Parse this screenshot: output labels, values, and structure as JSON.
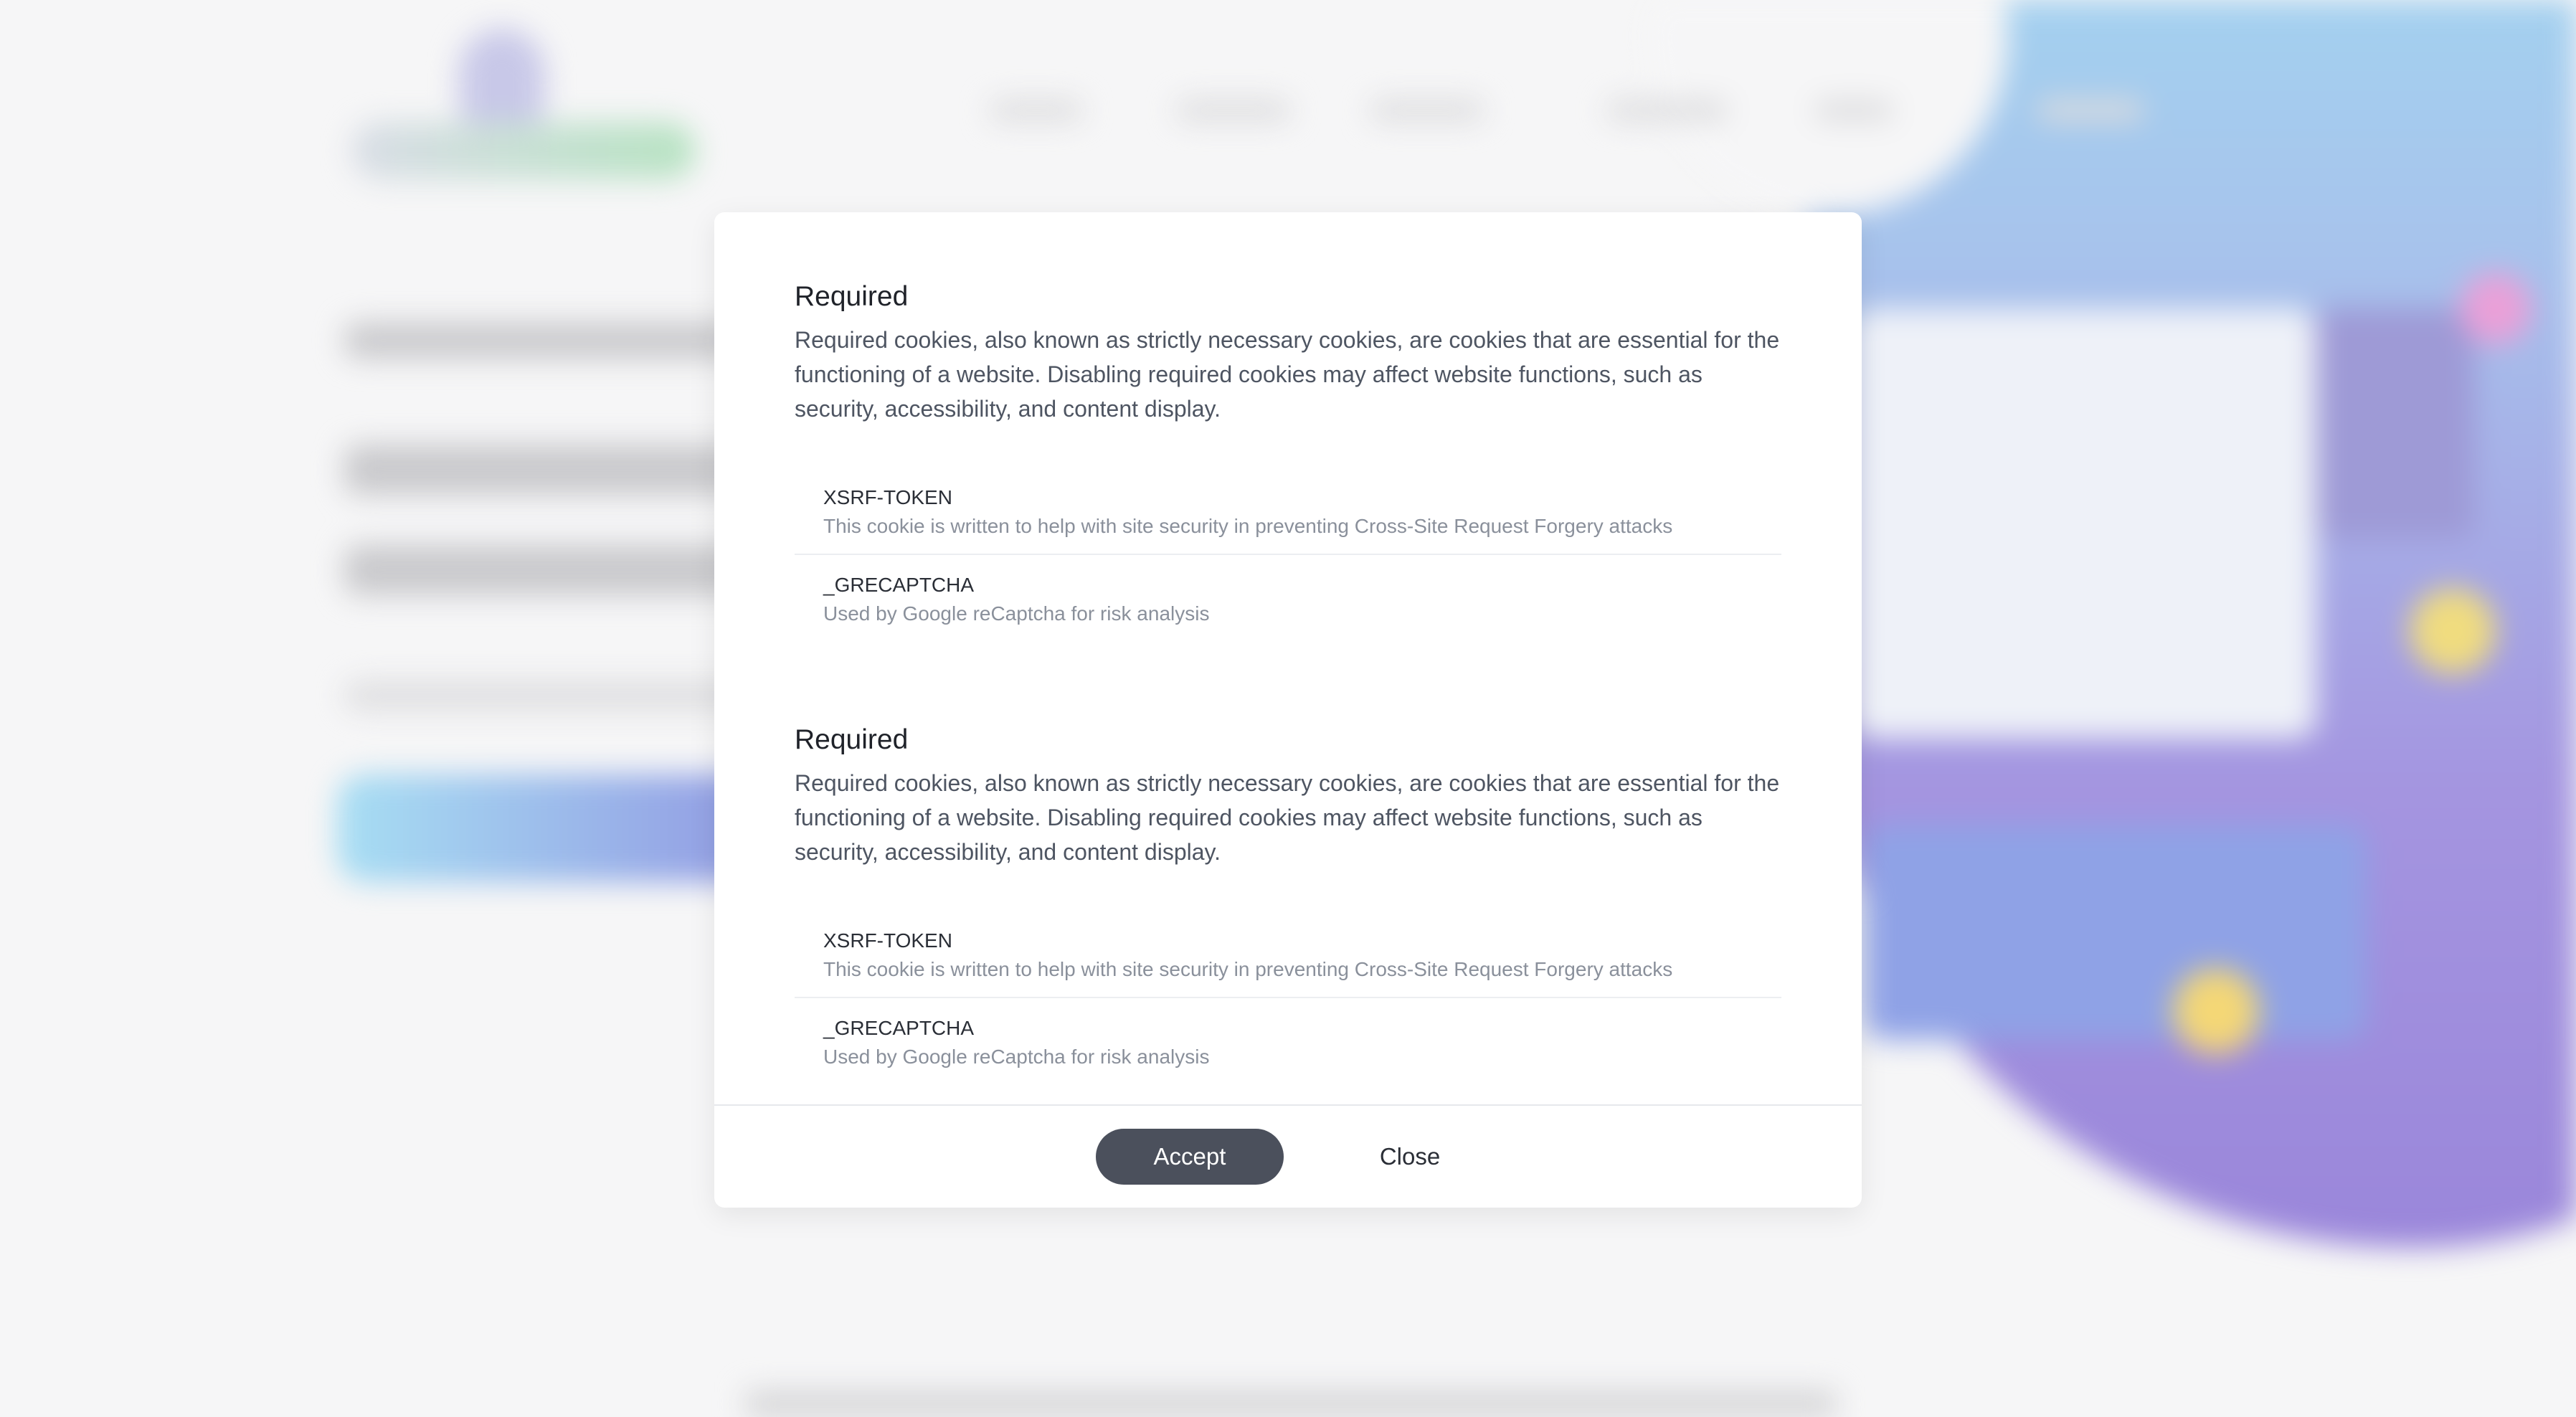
{
  "colors": {
    "accent_button": "#4b505c",
    "title_text": "#1f2229",
    "body_text": "#4e5562",
    "muted_text": "#8a909b",
    "modal_background": "#ffffff"
  },
  "modal": {
    "sections": [
      {
        "title": "Required",
        "description": "Required cookies, also known as strictly necessary cookies, are cookies that are essential for the functioning of a website. Disabling required cookies may affect website functions, such as security, accessibility, and content display.",
        "cookies": [
          {
            "name": "XSRF-TOKEN",
            "description": "This cookie is written to help with site security in preventing Cross-Site Request Forgery attacks"
          },
          {
            "name": "_GRECAPTCHA",
            "description": "Used by Google reCaptcha for risk analysis"
          }
        ]
      },
      {
        "title": "Required",
        "description": "Required cookies, also known as strictly necessary cookies, are cookies that are essential for the functioning of a website. Disabling required cookies may affect website functions, such as security, accessibility, and content display.",
        "cookies": [
          {
            "name": "XSRF-TOKEN",
            "description": "This cookie is written to help with site security in preventing Cross-Site Request Forgery attacks"
          },
          {
            "name": "_GRECAPTCHA",
            "description": "Used by Google reCaptcha for risk analysis"
          }
        ]
      }
    ],
    "footer": {
      "accept_label": "Accept",
      "close_label": "Close"
    }
  }
}
